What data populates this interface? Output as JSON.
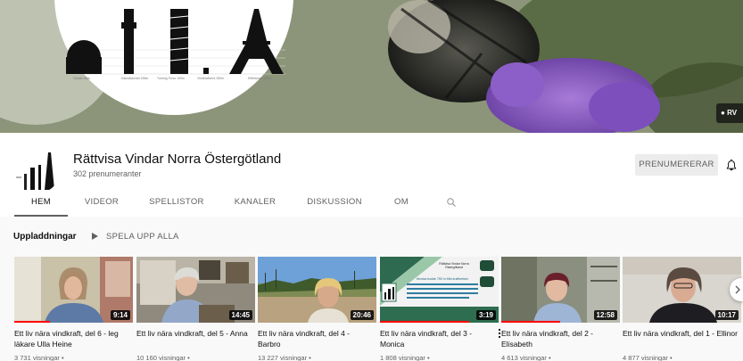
{
  "banner": {
    "badge_text": "RV",
    "chart_captions": [
      "Globen 85m",
      "Kaknästornet 155m",
      "Turning Torso 190m",
      "Vindkraftverk 250m",
      "Eiffeltornet 330m"
    ]
  },
  "channel": {
    "name": "Rättvisa Vindar Norra Östergötland",
    "subscribers": "302 prenumeranter",
    "subscribe_label": "PRENUMERERAR"
  },
  "tabs": [
    {
      "label": "HEM",
      "active": true
    },
    {
      "label": "VIDEOR"
    },
    {
      "label": "SPELLISTOR"
    },
    {
      "label": "KANALER"
    },
    {
      "label": "DISKUSSION"
    },
    {
      "label": "OM"
    }
  ],
  "shelf": {
    "title": "Uppladdningar",
    "play_all": "SPELA UPP ALLA"
  },
  "videos": [
    {
      "title": "Ett liv nära vindkraft, del 6 - leg läkare Ulla Heine",
      "duration": "9:14",
      "views": "3 731 visningar •",
      "progress": 0.3
    },
    {
      "title": "Ett liv nära vindkraft, del 5 - Anna",
      "duration": "14:45",
      "views": "10 160 visningar •",
      "progress": 0
    },
    {
      "title": "Ett liv nära vindkraft, del 4 - Barbro",
      "duration": "20:46",
      "views": "13 227 visningar •",
      "progress": 0
    },
    {
      "title": "Ett liv nära vindkraft, del 3 - Monica",
      "duration": "3:19",
      "views": "1 808 visningar •",
      "progress": 0.75
    },
    {
      "title": "Ett liv nära vindkraft, del 2 - Elisabeth",
      "duration": "12:58",
      "views": "4 613 visningar •",
      "progress": 0.5
    },
    {
      "title": "Ett liv nära vindkraft, del 1 - Ellinor",
      "duration": "10:17",
      "views": "4 877 visningar •",
      "progress": 0
    }
  ],
  "thumb3_text": {
    "org": "Rättvisa Vindar Norra Östergötland",
    "body": "Monica bodde 750 m från kraftverken"
  }
}
